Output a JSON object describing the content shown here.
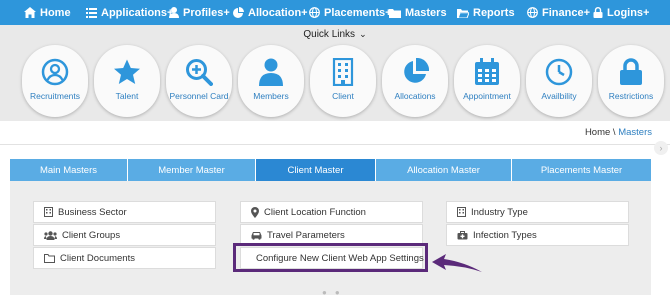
{
  "topnav": {
    "items": [
      {
        "label": "Home",
        "icon": "home-icon"
      },
      {
        "label": "Applications+",
        "icon": "list-icon"
      },
      {
        "label": "Profiles+",
        "icon": "user-icon"
      },
      {
        "label": "Allocation+",
        "icon": "pie-icon"
      },
      {
        "label": "Placements+",
        "icon": "globe-icon"
      },
      {
        "label": "Masters",
        "icon": "folder-icon"
      },
      {
        "label": "Reports",
        "icon": "folder-open-icon"
      },
      {
        "label": "Finance+",
        "icon": "globe-icon"
      },
      {
        "label": "Logins+",
        "icon": "lock-icon"
      }
    ]
  },
  "quick_links": {
    "title": "Quick Links",
    "items": [
      {
        "label": "Recruitments",
        "icon": "user-circle-icon"
      },
      {
        "label": "Talent",
        "icon": "star-icon"
      },
      {
        "label": "Personnel Card",
        "icon": "search-plus-icon"
      },
      {
        "label": "Members",
        "icon": "user-icon"
      },
      {
        "label": "Client",
        "icon": "building-icon"
      },
      {
        "label": "Allocations",
        "icon": "pie-chart-icon"
      },
      {
        "label": "Appointment",
        "icon": "calendar-icon"
      },
      {
        "label": "Availbility",
        "icon": "clock-icon"
      },
      {
        "label": "Restrictions",
        "icon": "lock-icon"
      }
    ]
  },
  "breadcrumb": {
    "home": "Home",
    "separator": "\\",
    "current": "Masters"
  },
  "tabs": [
    {
      "label": "Main Masters",
      "active": false
    },
    {
      "label": "Member Master",
      "active": false
    },
    {
      "label": "Client Master",
      "active": true
    },
    {
      "label": "Allocation Master",
      "active": false
    },
    {
      "label": "Placements Master",
      "active": false
    }
  ],
  "client_master": {
    "business_sector": "Business Sector",
    "client_groups": "Client Groups",
    "client_documents": "Client Documents",
    "client_location_function": "Client Location Function",
    "travel_parameters": "Travel Parameters",
    "configure_web_app": "Configure New Client Web App Settings",
    "industry_type": "Industry Type",
    "infection_types": "Infection Types"
  },
  "colors": {
    "nav": "#2e96db",
    "tab": "#5aace4",
    "tab_active": "#2b88d3",
    "highlight": "#5b2a7a",
    "link": "#2e7fc0"
  }
}
